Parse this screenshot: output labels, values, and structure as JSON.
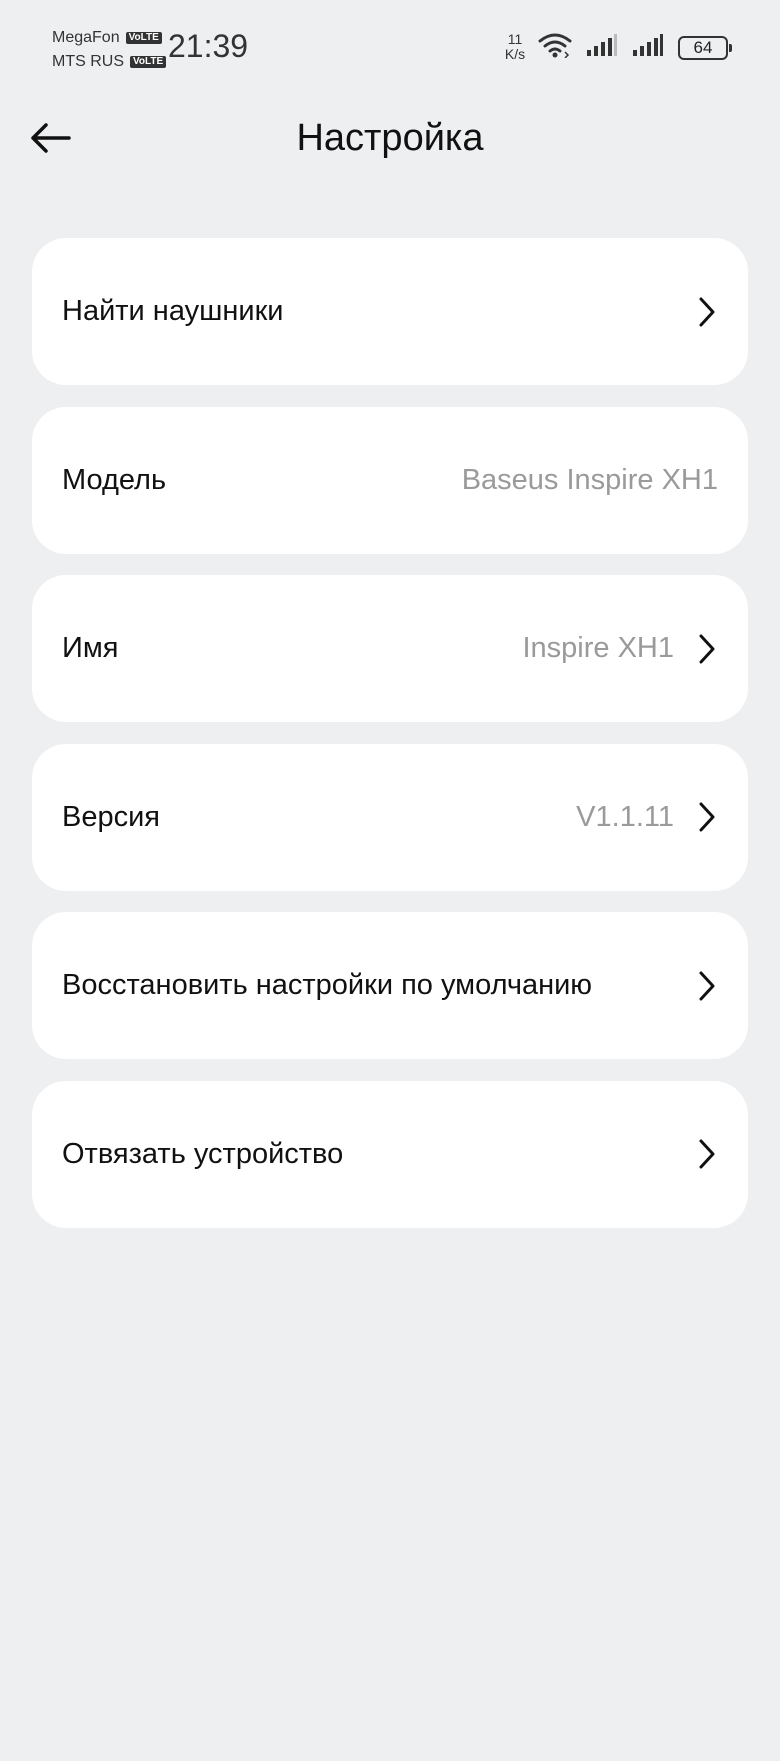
{
  "status_bar": {
    "carrier1": "MegaFon",
    "carrier2": "MTS RUS",
    "volte_badge": "VoLTE",
    "time": "21:39",
    "net_speed_value": "11",
    "net_speed_unit": "K/s",
    "battery": "64",
    "icons": [
      "wifi-icon",
      "signal-icon",
      "signal-icon",
      "battery-icon"
    ]
  },
  "header": {
    "title": "Настройка",
    "back_icon": "arrow-left-icon"
  },
  "items": [
    {
      "label": "Найти наушники",
      "value": ""
    },
    {
      "label": "Модель",
      "value": "Baseus Inspire XH1"
    },
    {
      "label": "Имя",
      "value": "Inspire XH1"
    },
    {
      "label": "Версия",
      "value": "V1.1.11"
    },
    {
      "label": "Восстановить настройки по умолчанию",
      "value": ""
    },
    {
      "label": "Отвязать устройство",
      "value": ""
    }
  ],
  "colors": {
    "background": "#eeeff1",
    "card": "#ffffff",
    "secondary_text": "#9a9a9a"
  }
}
